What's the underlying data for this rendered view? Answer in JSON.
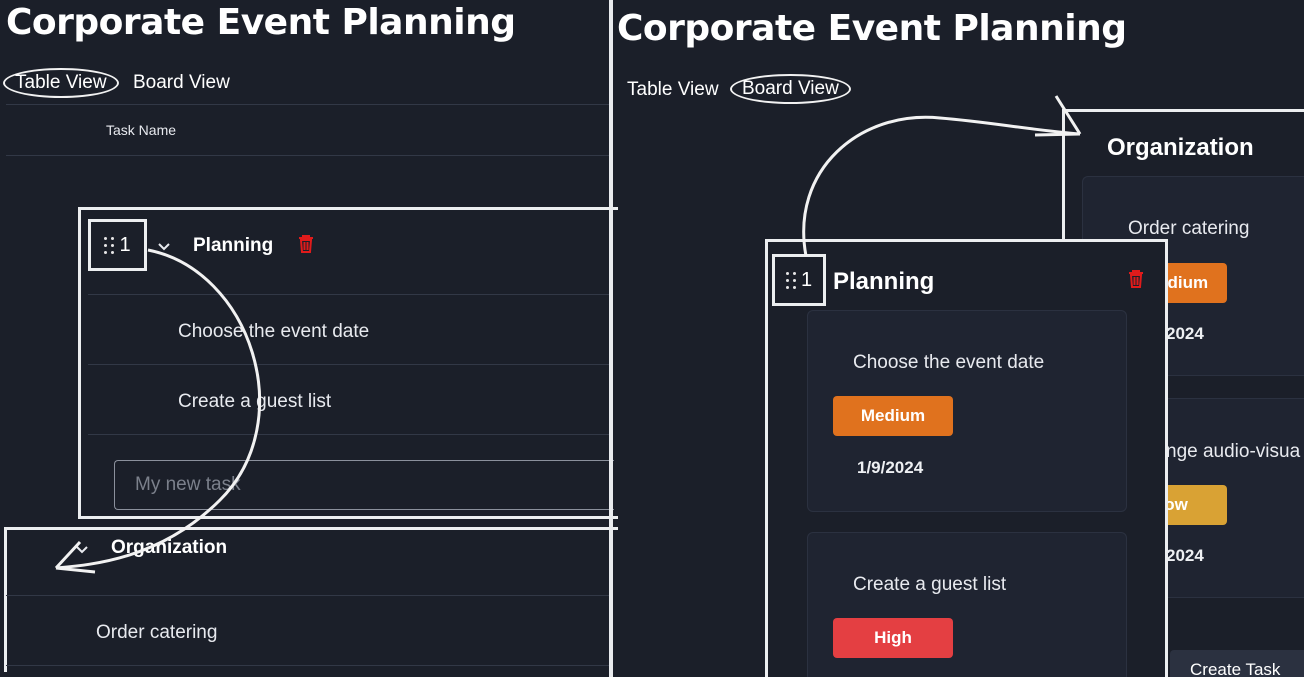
{
  "left": {
    "title": "Corporate Event Planning",
    "tabs": {
      "table_view": "Table View",
      "board_view": "Board View"
    },
    "table_header": {
      "task_name": "Task Name"
    },
    "group_planning": {
      "index": "1",
      "name": "Planning",
      "tasks": [
        "Choose the event date",
        "Create a guest list"
      ],
      "new_task_placeholder": "My new task"
    },
    "group_organization": {
      "name": "Organization",
      "tasks": [
        "Order catering"
      ]
    }
  },
  "right": {
    "title": "Corporate Event Planning",
    "tabs": {
      "table_view": "Table View",
      "board_view": "Board View"
    },
    "column_organization": {
      "name": "Organization",
      "cards": [
        {
          "title": "Order catering",
          "priority": "Medium",
          "date": "2024"
        },
        {
          "title": "nge audio-visua",
          "priority": "ow",
          "date": "2024"
        }
      ]
    },
    "column_planning": {
      "index": "1",
      "name": "Planning",
      "cards": [
        {
          "title": "Choose the event date",
          "priority": "Medium",
          "date": "1/9/2024"
        },
        {
          "title": "Create a guest list",
          "priority": "High"
        }
      ]
    },
    "create_task_label": "Create Task"
  },
  "colors": {
    "background": "#1b1f29",
    "medium": "#e0721e",
    "low": "#d9a234",
    "high": "#e43f42",
    "delete": "#e01b1b"
  },
  "icons": [
    "drag-handle-icon",
    "chevron-down-icon",
    "trash-icon"
  ]
}
